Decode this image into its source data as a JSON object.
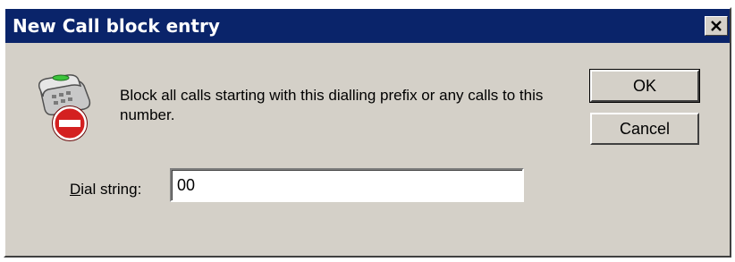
{
  "window": {
    "title": "New Call block entry",
    "close_glyph": "✕"
  },
  "message": "Block all calls starting with this dialling prefix or any calls to this number.",
  "buttons": {
    "ok": "OK",
    "cancel": "Cancel"
  },
  "dial_string": {
    "label_accel": "D",
    "label_rest": "ial string:",
    "value": "00"
  },
  "icons": {
    "title_close": "close-icon",
    "main": "blocked-phone-icon"
  },
  "colors": {
    "titlebar": "#0a246a",
    "dialog_face": "#d4d0c8",
    "block_red": "#d42020"
  }
}
